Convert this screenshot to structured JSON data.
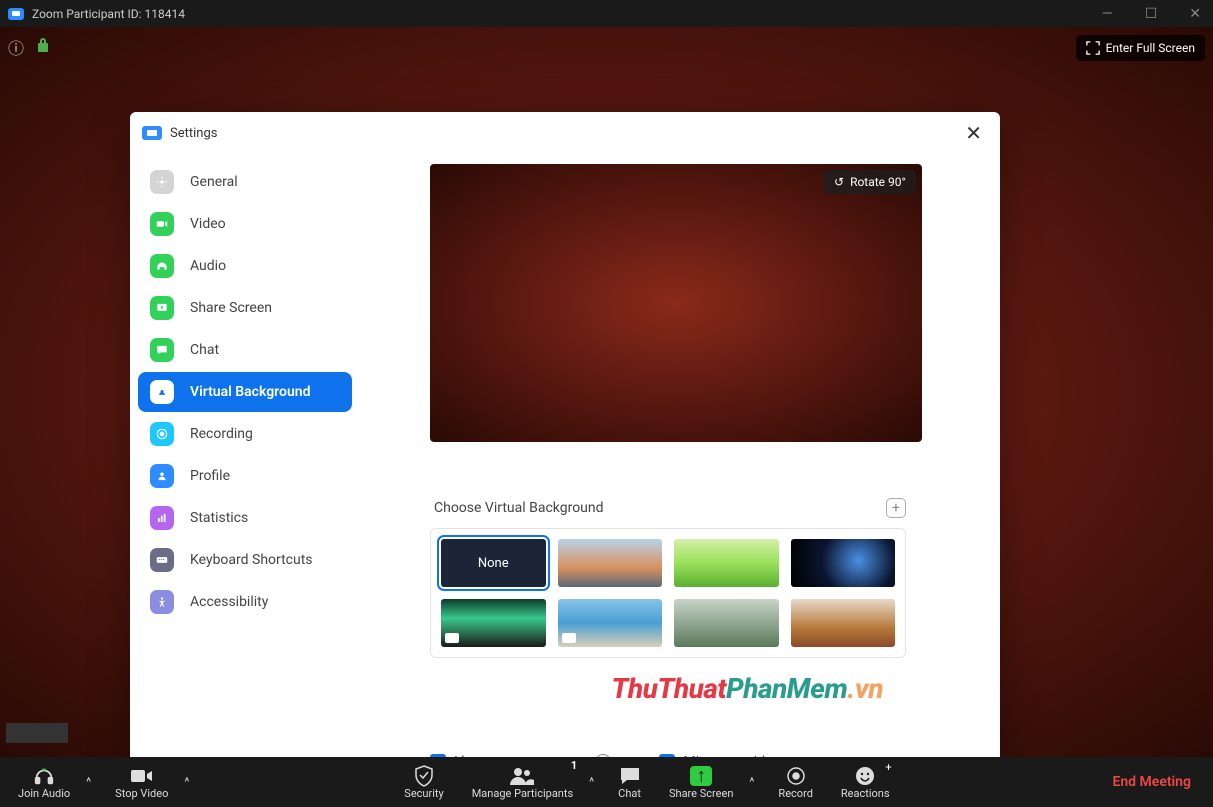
{
  "titlebar": {
    "title": "Zoom Participant ID: 118414"
  },
  "fullscreen_label": "Enter Full Screen",
  "settings": {
    "title": "Settings",
    "nav": {
      "general": "General",
      "video": "Video",
      "audio": "Audio",
      "share": "Share Screen",
      "chat": "Chat",
      "vbg": "Virtual Background",
      "recording": "Recording",
      "profile": "Profile",
      "stats": "Statistics",
      "keyboard": "Keyboard Shortcuts",
      "accessibility": "Accessibility"
    },
    "rotate_label": "Rotate 90°",
    "choose_label": "Choose Virtual Background",
    "thumbs": {
      "none": "None"
    },
    "green_screen_label": "I have a green screen",
    "mirror_label": "Mirror my video",
    "green_screen_checked": true,
    "mirror_checked": true
  },
  "toolbar": {
    "join_audio": "Join Audio",
    "stop_video": "Stop Video",
    "security": "Security",
    "participants": "Manage Participants",
    "participants_count": "1",
    "chat": "Chat",
    "share": "Share Screen",
    "record": "Record",
    "reactions": "Reactions",
    "end": "End Meeting"
  },
  "watermark": {
    "a": "ThuThuat",
    "b": "PhanMem",
    "c": ".vn"
  }
}
